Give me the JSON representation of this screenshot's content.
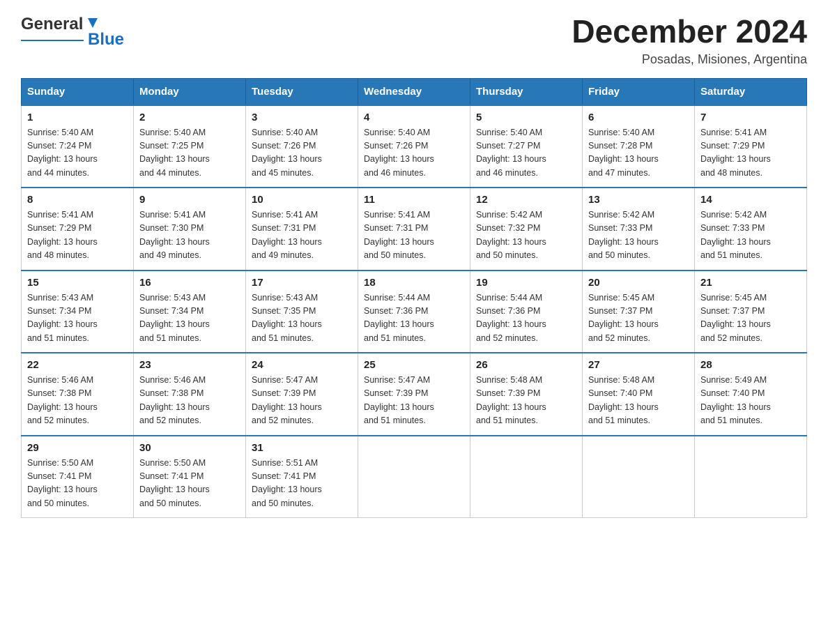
{
  "header": {
    "month_year": "December 2024",
    "location": "Posadas, Misiones, Argentina",
    "logo_general": "General",
    "logo_blue": "Blue"
  },
  "days_of_week": [
    "Sunday",
    "Monday",
    "Tuesday",
    "Wednesday",
    "Thursday",
    "Friday",
    "Saturday"
  ],
  "weeks": [
    [
      {
        "day": "1",
        "sunrise": "5:40 AM",
        "sunset": "7:24 PM",
        "daylight": "13 hours and 44 minutes."
      },
      {
        "day": "2",
        "sunrise": "5:40 AM",
        "sunset": "7:25 PM",
        "daylight": "13 hours and 44 minutes."
      },
      {
        "day": "3",
        "sunrise": "5:40 AM",
        "sunset": "7:26 PM",
        "daylight": "13 hours and 45 minutes."
      },
      {
        "day": "4",
        "sunrise": "5:40 AM",
        "sunset": "7:26 PM",
        "daylight": "13 hours and 46 minutes."
      },
      {
        "day": "5",
        "sunrise": "5:40 AM",
        "sunset": "7:27 PM",
        "daylight": "13 hours and 46 minutes."
      },
      {
        "day": "6",
        "sunrise": "5:40 AM",
        "sunset": "7:28 PM",
        "daylight": "13 hours and 47 minutes."
      },
      {
        "day": "7",
        "sunrise": "5:41 AM",
        "sunset": "7:29 PM",
        "daylight": "13 hours and 48 minutes."
      }
    ],
    [
      {
        "day": "8",
        "sunrise": "5:41 AM",
        "sunset": "7:29 PM",
        "daylight": "13 hours and 48 minutes."
      },
      {
        "day": "9",
        "sunrise": "5:41 AM",
        "sunset": "7:30 PM",
        "daylight": "13 hours and 49 minutes."
      },
      {
        "day": "10",
        "sunrise": "5:41 AM",
        "sunset": "7:31 PM",
        "daylight": "13 hours and 49 minutes."
      },
      {
        "day": "11",
        "sunrise": "5:41 AM",
        "sunset": "7:31 PM",
        "daylight": "13 hours and 50 minutes."
      },
      {
        "day": "12",
        "sunrise": "5:42 AM",
        "sunset": "7:32 PM",
        "daylight": "13 hours and 50 minutes."
      },
      {
        "day": "13",
        "sunrise": "5:42 AM",
        "sunset": "7:33 PM",
        "daylight": "13 hours and 50 minutes."
      },
      {
        "day": "14",
        "sunrise": "5:42 AM",
        "sunset": "7:33 PM",
        "daylight": "13 hours and 51 minutes."
      }
    ],
    [
      {
        "day": "15",
        "sunrise": "5:43 AM",
        "sunset": "7:34 PM",
        "daylight": "13 hours and 51 minutes."
      },
      {
        "day": "16",
        "sunrise": "5:43 AM",
        "sunset": "7:34 PM",
        "daylight": "13 hours and 51 minutes."
      },
      {
        "day": "17",
        "sunrise": "5:43 AM",
        "sunset": "7:35 PM",
        "daylight": "13 hours and 51 minutes."
      },
      {
        "day": "18",
        "sunrise": "5:44 AM",
        "sunset": "7:36 PM",
        "daylight": "13 hours and 51 minutes."
      },
      {
        "day": "19",
        "sunrise": "5:44 AM",
        "sunset": "7:36 PM",
        "daylight": "13 hours and 52 minutes."
      },
      {
        "day": "20",
        "sunrise": "5:45 AM",
        "sunset": "7:37 PM",
        "daylight": "13 hours and 52 minutes."
      },
      {
        "day": "21",
        "sunrise": "5:45 AM",
        "sunset": "7:37 PM",
        "daylight": "13 hours and 52 minutes."
      }
    ],
    [
      {
        "day": "22",
        "sunrise": "5:46 AM",
        "sunset": "7:38 PM",
        "daylight": "13 hours and 52 minutes."
      },
      {
        "day": "23",
        "sunrise": "5:46 AM",
        "sunset": "7:38 PM",
        "daylight": "13 hours and 52 minutes."
      },
      {
        "day": "24",
        "sunrise": "5:47 AM",
        "sunset": "7:39 PM",
        "daylight": "13 hours and 52 minutes."
      },
      {
        "day": "25",
        "sunrise": "5:47 AM",
        "sunset": "7:39 PM",
        "daylight": "13 hours and 51 minutes."
      },
      {
        "day": "26",
        "sunrise": "5:48 AM",
        "sunset": "7:39 PM",
        "daylight": "13 hours and 51 minutes."
      },
      {
        "day": "27",
        "sunrise": "5:48 AM",
        "sunset": "7:40 PM",
        "daylight": "13 hours and 51 minutes."
      },
      {
        "day": "28",
        "sunrise": "5:49 AM",
        "sunset": "7:40 PM",
        "daylight": "13 hours and 51 minutes."
      }
    ],
    [
      {
        "day": "29",
        "sunrise": "5:50 AM",
        "sunset": "7:41 PM",
        "daylight": "13 hours and 50 minutes."
      },
      {
        "day": "30",
        "sunrise": "5:50 AM",
        "sunset": "7:41 PM",
        "daylight": "13 hours and 50 minutes."
      },
      {
        "day": "31",
        "sunrise": "5:51 AM",
        "sunset": "7:41 PM",
        "daylight": "13 hours and 50 minutes."
      },
      null,
      null,
      null,
      null
    ]
  ],
  "labels": {
    "sunrise": "Sunrise:",
    "sunset": "Sunset:",
    "daylight": "Daylight:"
  }
}
